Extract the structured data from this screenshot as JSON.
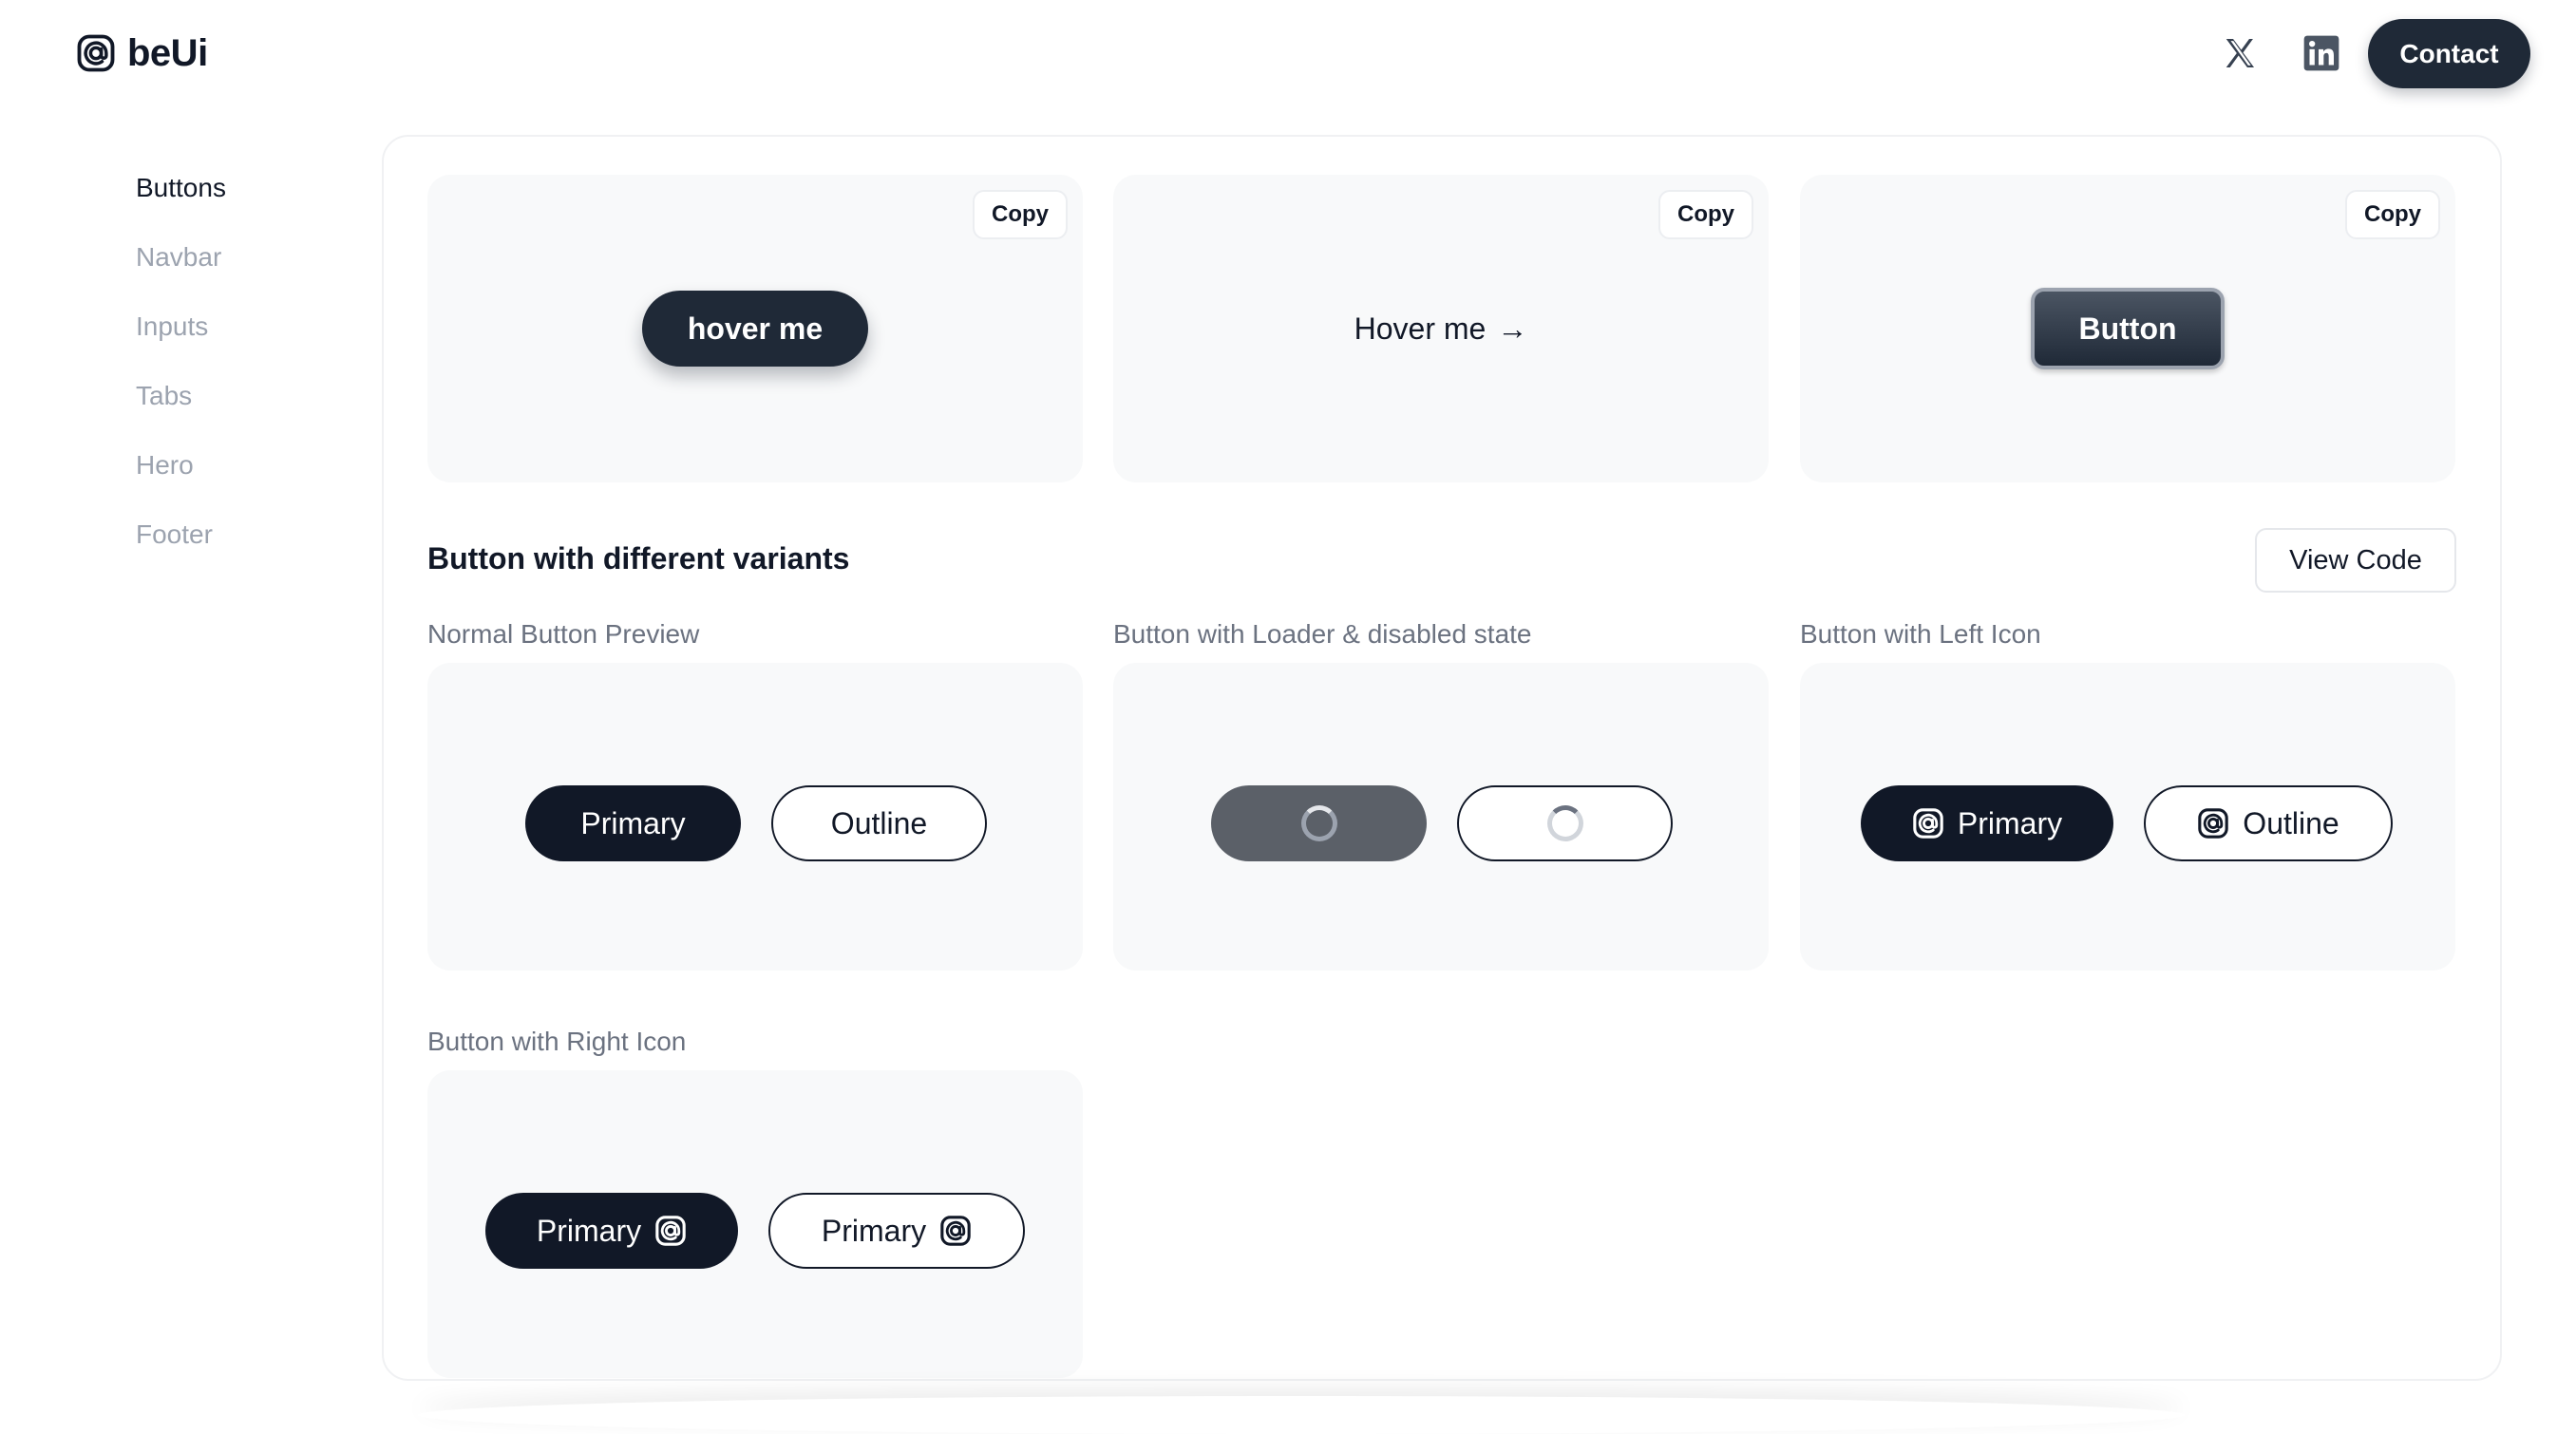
{
  "brand": {
    "name": "beUi",
    "logo_icon": "at-square-icon"
  },
  "header": {
    "x_icon": "x-twitter-icon",
    "linkedin_icon": "linkedin-icon",
    "contact_label": "Contact"
  },
  "sidebar": {
    "items": [
      {
        "label": "Buttons",
        "active": true
      },
      {
        "label": "Navbar",
        "active": false
      },
      {
        "label": "Inputs",
        "active": false
      },
      {
        "label": "Tabs",
        "active": false
      },
      {
        "label": "Hero",
        "active": false
      },
      {
        "label": "Footer",
        "active": false
      }
    ]
  },
  "top_cards": [
    {
      "copy_label": "Copy",
      "button_label": "hover me"
    },
    {
      "copy_label": "Copy",
      "button_label": "Hover me",
      "arrow": "→"
    },
    {
      "copy_label": "Copy",
      "button_label": "Button"
    }
  ],
  "variants": {
    "title": "Button with different variants",
    "view_code_label": "View Code",
    "normal": {
      "label": "Normal Button Preview",
      "primary": "Primary",
      "outline": "Outline"
    },
    "loader": {
      "label": "Button with Loader & disabled state"
    },
    "left_icon": {
      "label": "Button with Left Icon",
      "primary": "Primary",
      "outline": "Outline",
      "icon": "at-square-icon"
    },
    "right_icon": {
      "label": "Button with Right Icon",
      "primary": "Primary",
      "outline": "Primary",
      "icon": "at-square-icon"
    }
  },
  "colors": {
    "dark": "#111827",
    "muted": "#9ca3af",
    "card_bg": "#f8f9fa",
    "disabled": "#5b6068"
  }
}
